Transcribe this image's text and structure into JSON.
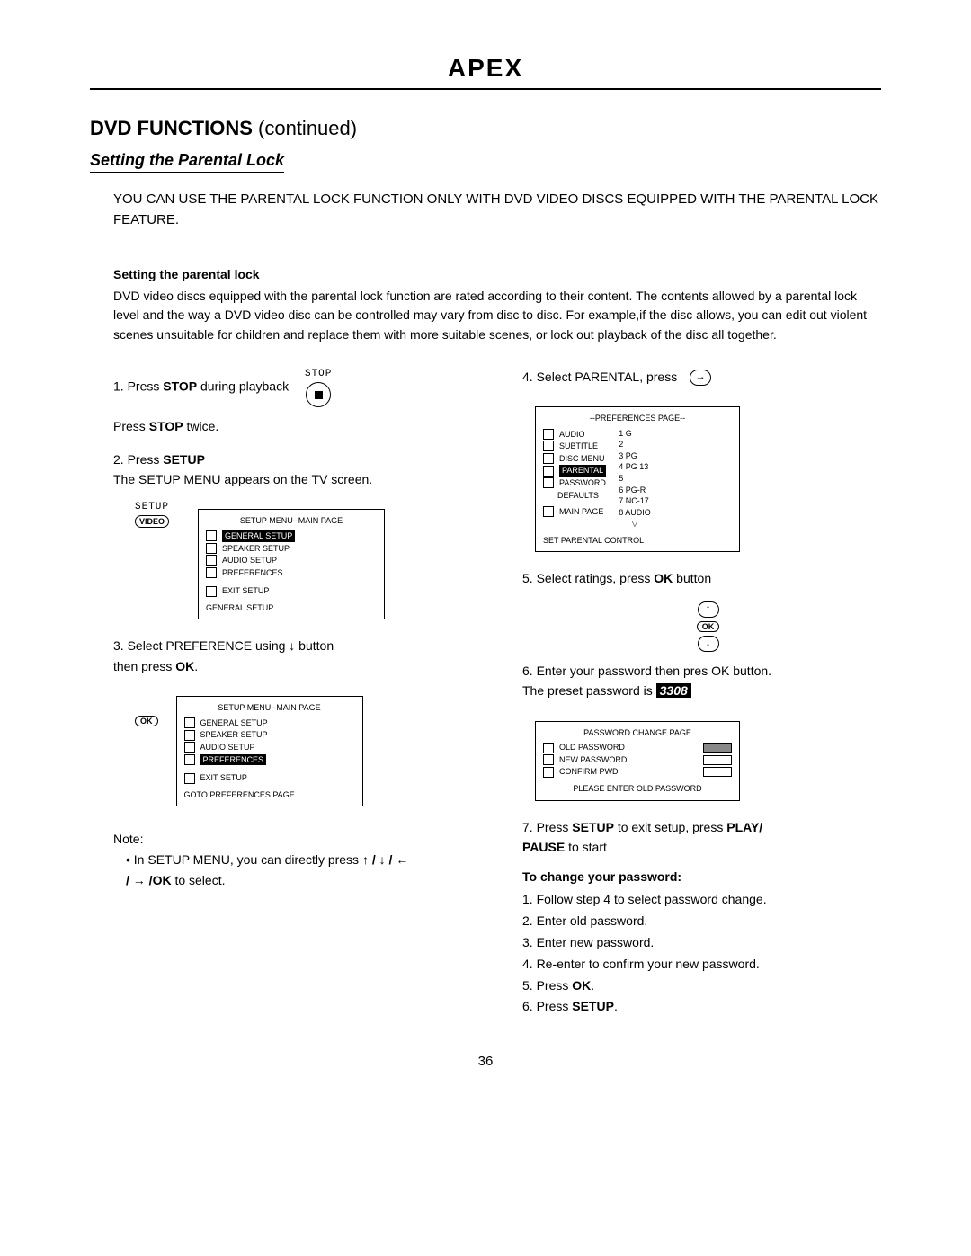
{
  "brand": "APEX",
  "heading": {
    "main": "DVD FUNCTIONS",
    "cont": "(continued)"
  },
  "subheading": "Setting the Parental Lock",
  "intro": "YOU CAN USE THE PARENTAL LOCK FUNCTION ONLY WITH DVD VIDEO DISCS EQUIPPED WITH THE PARENTAL LOCK FEATURE.",
  "para_heading": "Setting the parental lock",
  "para_body": "DVD video discs equipped with the parental lock function are rated according to their content. The contents allowed by a parental lock level and the way a DVD video disc can be controlled may vary from disc to disc. For example,if the disc allows, you can edit out violent scenes unsuitable for children and replace them with more suitable scenes, or lock out playback of the disc all together.",
  "left": {
    "step1a_pre": "1. Press ",
    "step1a_bold": "STOP",
    "step1a_post": " during playback",
    "stop_label": "STOP",
    "step1b_pre": "Press ",
    "step1b_bold": "STOP",
    "step1b_post": " twice.",
    "step2_pre": "2. Press ",
    "step2_bold": "SETUP",
    "step2_line2": "The SETUP MENU appears on the TV screen.",
    "setup_label": "SETUP",
    "setup_oval": "VIDEO",
    "osd1": {
      "title": "SETUP MENU--MAIN PAGE",
      "i1": "GENERAL SETUP",
      "i2": "SPEAKER SETUP",
      "i3": "AUDIO SETUP",
      "i4": "PREFERENCES",
      "i5": "EXIT SETUP",
      "foot": "GENERAL SETUP"
    },
    "step3_pre": "3. Select PREFERENCE using ",
    "step3_arrow": "↓",
    "step3_post": " button",
    "step3_line2_pre": "then press ",
    "step3_line2_bold": "OK",
    "step3_line2_post": ".",
    "ok_label": "OK",
    "osd2": {
      "title": "SETUP MENU--MAIN PAGE",
      "i1": "GENERAL SETUP",
      "i2": "SPEAKER SETUP",
      "i3": "AUDIO SETUP",
      "i4": "PREFERENCES",
      "i5": "EXIT SETUP",
      "foot": "GOTO PREFERENCES PAGE"
    },
    "note_label": "Note:",
    "note_bullet_pre": "• In SETUP MENU, you can directly press ",
    "note_arrows": "↑ / ↓ / ←",
    "note_line2_pre": "/ → /",
    "note_line2_bold": "OK",
    "note_line2_post": " to select."
  },
  "right": {
    "step4": "4. Select PARENTAL, press",
    "arrow_right": "→",
    "osd3": {
      "title": "--PREFERENCES PAGE--",
      "l1": "AUDIO",
      "r1": "1 G",
      "l2": "SUBTITLE",
      "r2": "2",
      "l3": "DISC MENU",
      "r3": "3 PG",
      "l4": "PARENTAL",
      "r4": "4 PG 13",
      "l5": "PASSWORD",
      "r5": "5",
      "l6": "DEFAULTS",
      "r6": "6 PG-R",
      "r7": "7 NC-17",
      "l8": "MAIN PAGE",
      "r8": "8 AUDIO",
      "tri": "▽",
      "foot": "SET PARENTAL CONTROL"
    },
    "step5_pre": "5. Select ratings, press ",
    "step5_bold": "OK",
    "step5_post": " button",
    "ok_label": "OK",
    "up": "↑",
    "down": "↓",
    "step6": "6. Enter your password then pres OK button.",
    "step6_line2_pre": "The preset password is ",
    "preset_pw": "3308",
    "osd4": {
      "title": "PASSWORD CHANGE PAGE",
      "l1": "OLD PASSWORD",
      "l2": "NEW PASSWORD",
      "l3": "CONFIRM PWD",
      "foot": "PLEASE ENTER OLD PASSWORD"
    },
    "step7_pre": "7. Press ",
    "step7_b1": "SETUP",
    "step7_mid": " to exit setup, press ",
    "step7_b2": "PLAY/",
    "step7_line2_b": "PAUSE",
    "step7_line2_post": " to start",
    "pw_heading": "To change your password:",
    "pw1": "1. Follow step 4 to select password change.",
    "pw2": "2. Enter old password.",
    "pw3": "3. Enter new password.",
    "pw4": "4. Re-enter to confirm your new password.",
    "pw5_pre": "5. Press ",
    "pw5_bold": "OK",
    "pw5_post": ".",
    "pw6_pre": "6. Press ",
    "pw6_bold": "SETUP",
    "pw6_post": "."
  },
  "page_number": "36"
}
